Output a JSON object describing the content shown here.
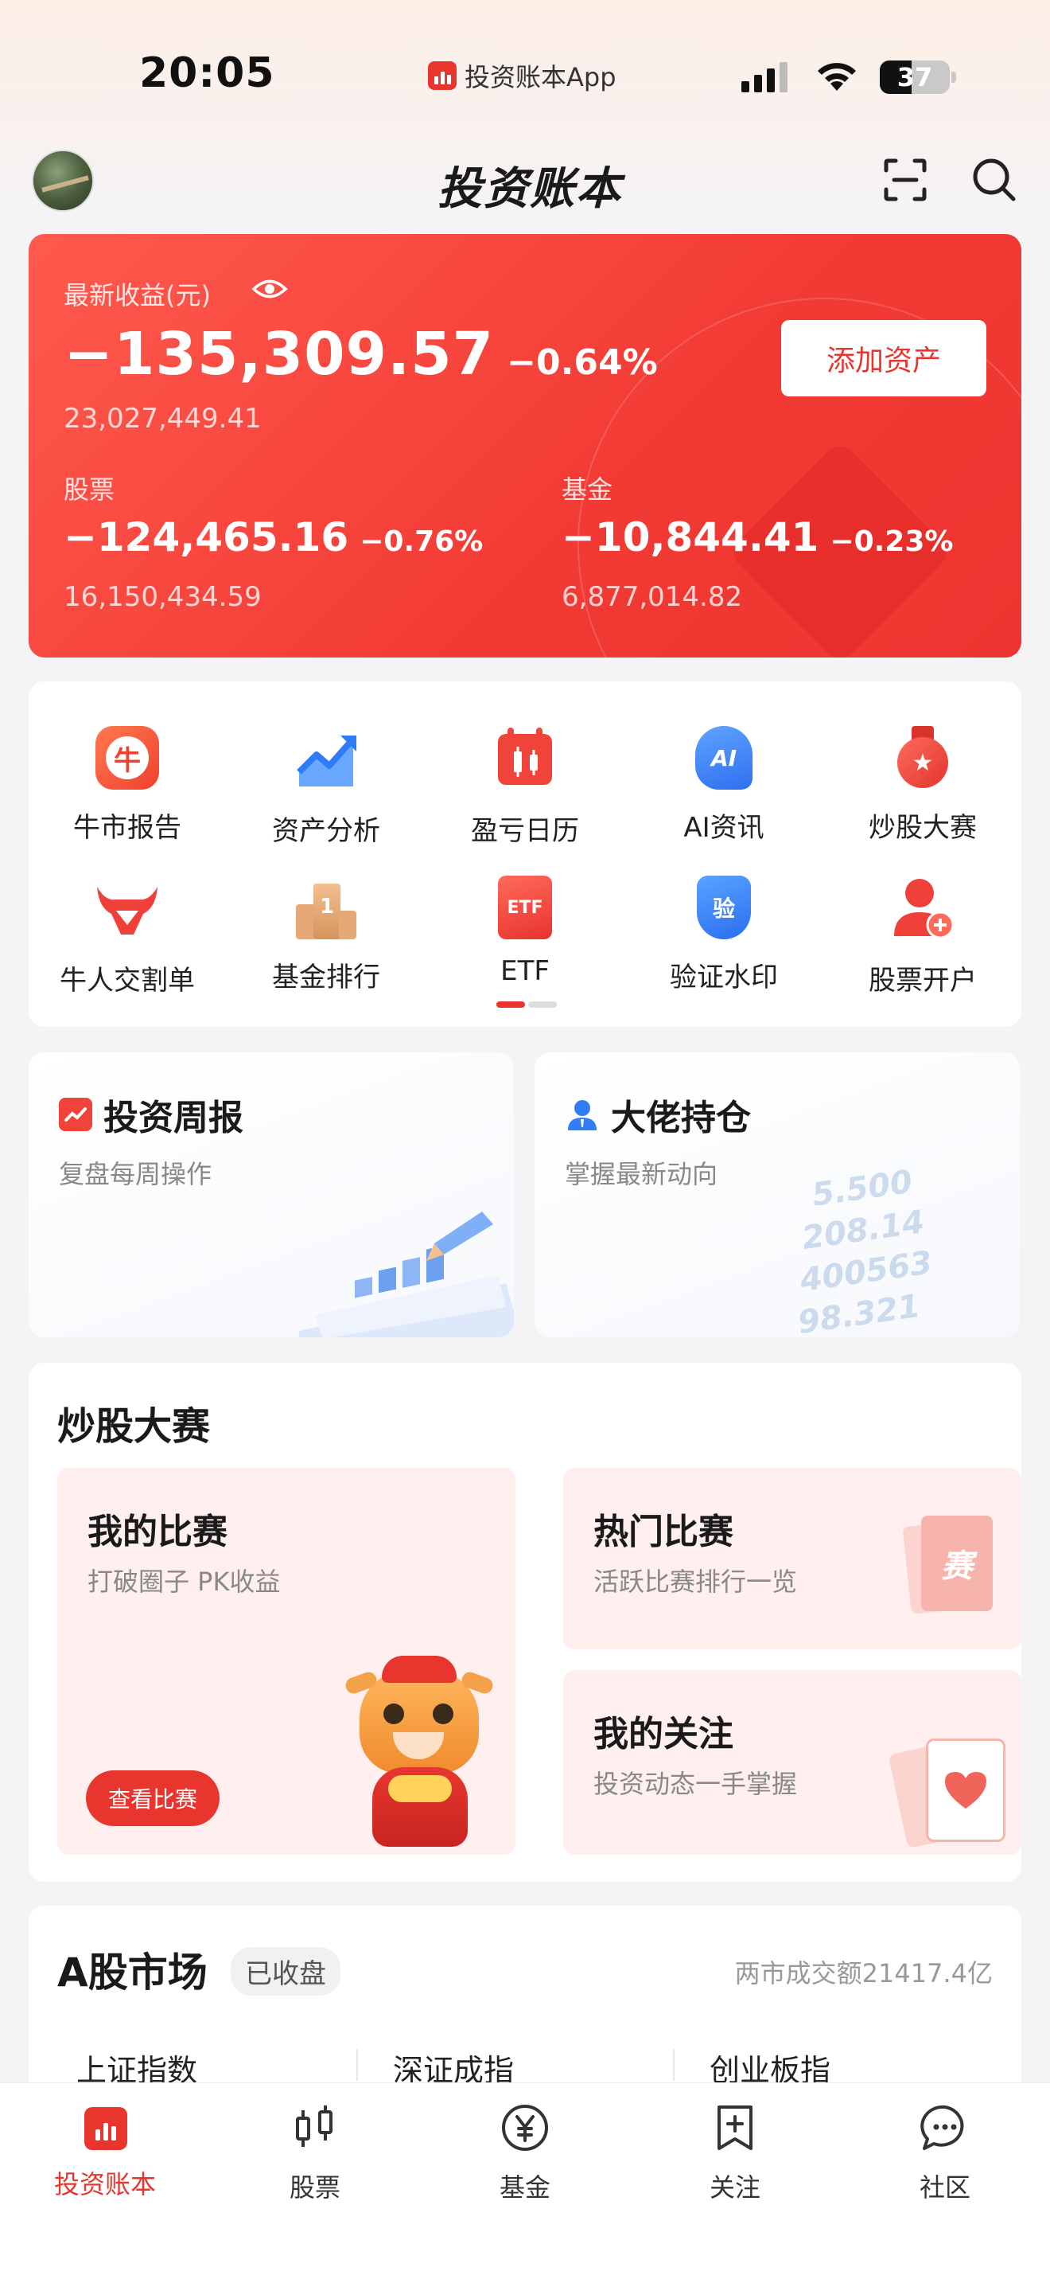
{
  "status_bar": {
    "time": "20:05",
    "app_name": "投资账本App",
    "battery": "37"
  },
  "header": {
    "brand": "投资账本"
  },
  "summary": {
    "latest_label": "最新收益(元)",
    "latest_value": "−135,309.57",
    "latest_pct": "−0.64%",
    "total_assets": "23,027,449.41",
    "add_button": "添加资产",
    "stocks": {
      "label": "股票",
      "value": "−124,465.16",
      "pct": "−0.76%",
      "assets": "16,150,434.59"
    },
    "funds": {
      "label": "基金",
      "value": "−10,844.41",
      "pct": "−0.23%",
      "assets": "6,877,014.82"
    }
  },
  "shortcuts": [
    {
      "label": "牛市报告",
      "icon": "bull-report-icon",
      "glyph": "牛"
    },
    {
      "label": "资产分析",
      "icon": "trend-chart-icon",
      "glyph": ""
    },
    {
      "label": "盈亏日历",
      "icon": "calendar-icon",
      "glyph": ""
    },
    {
      "label": "AI资讯",
      "icon": "ai-head-icon",
      "glyph": "AI"
    },
    {
      "label": "炒股大赛",
      "icon": "medal-icon",
      "glyph": "★"
    },
    {
      "label": "牛人交割单",
      "icon": "bull-head-icon",
      "glyph": ""
    },
    {
      "label": "基金排行",
      "icon": "podium-icon",
      "glyph": "1"
    },
    {
      "label": "ETF",
      "icon": "etf-ticket-icon",
      "glyph": "ETF"
    },
    {
      "label": "验证水印",
      "icon": "verify-shield-icon",
      "glyph": "验"
    },
    {
      "label": "股票开户",
      "icon": "add-user-icon",
      "glyph": ""
    }
  ],
  "feature_cards": {
    "weekly": {
      "title": "投资周报",
      "subtitle": "复盘每周操作"
    },
    "holdings": {
      "title": "大佬持仓",
      "subtitle": "掌握最新动向",
      "deco_numbers": [
        "5.500",
        "208.14",
        "400563",
        "98.321"
      ]
    }
  },
  "contest": {
    "title": "炒股大赛",
    "my": {
      "title": "我的比赛",
      "subtitle": "打破圈子 PK收益",
      "button": "查看比赛"
    },
    "hot": {
      "title": "热门比赛",
      "subtitle": "活跃比赛排行一览",
      "badge": "赛"
    },
    "follow": {
      "title": "我的关注",
      "subtitle": "投资动态一手掌握"
    }
  },
  "market": {
    "title": "A股市场",
    "status": "已收盘",
    "turnover": "两市成交额21417.4亿",
    "indices": [
      "上证指数",
      "深证成指",
      "创业板指"
    ]
  },
  "bottom_nav": [
    {
      "label": "投资账本",
      "icon": "ledger-icon",
      "active": true
    },
    {
      "label": "股票",
      "icon": "candlestick-icon",
      "active": false
    },
    {
      "label": "基金",
      "icon": "yen-circle-icon",
      "active": false
    },
    {
      "label": "关注",
      "icon": "bookmark-plus-icon",
      "active": false
    },
    {
      "label": "社区",
      "icon": "chat-bubble-icon",
      "active": false
    }
  ],
  "colors": {
    "accent": "#e8362f",
    "card_red": "#f23a34",
    "pale_red": "#fff0ef"
  }
}
